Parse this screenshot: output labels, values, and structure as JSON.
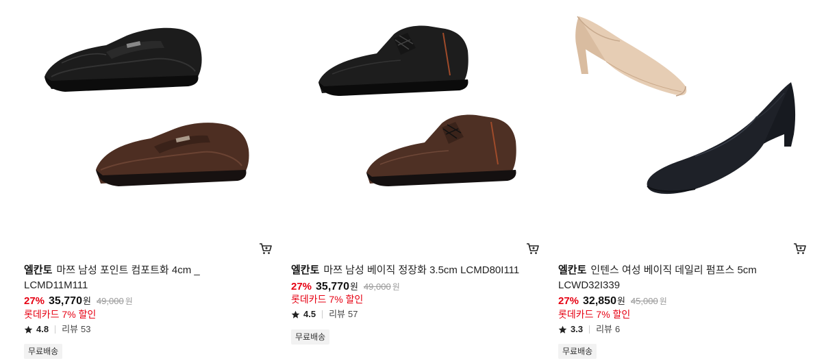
{
  "products": [
    {
      "brand": "엘칸토",
      "name": "마쯔 남성 포인트 컴포트화 4cm _ LCMD11M111",
      "discount_rate": "27%",
      "price": "35,770",
      "currency": "원",
      "original_price": "49,000",
      "original_currency": "원",
      "card_discount": "롯데카드 7% 할인",
      "rating": "4.8",
      "review_label": "리뷰",
      "review_count": "53",
      "badge": "무료배송",
      "image_icon": "shoe-loafer-black-brown",
      "colors": [
        "#1b1b1b",
        "#4a2c20"
      ]
    },
    {
      "brand": "엘칸토",
      "name": "마쯔 남성 베이직 정장화 3.5cm LCMD80I111",
      "discount_rate": "27%",
      "price": "35,770",
      "currency": "원",
      "original_price": "49,000",
      "original_currency": "원",
      "card_discount": "롯데카드 7% 할인",
      "rating": "4.5",
      "review_label": "리뷰",
      "review_count": "57",
      "badge": "무료배송",
      "image_icon": "shoe-oxford-black-brown",
      "colors": [
        "#1a1a1a",
        "#4b2e22"
      ]
    },
    {
      "brand": "엘칸토",
      "name": "인텐스 여성 베이직 데일리 펌프스 5cm LCWD32I339",
      "discount_rate": "27%",
      "price": "32,850",
      "currency": "원",
      "original_price": "45,000",
      "original_currency": "원",
      "card_discount": "롯데카드 7% 할인",
      "rating": "3.3",
      "review_label": "리뷰",
      "review_count": "6",
      "badge": "무료배송",
      "image_icon": "shoe-pump-beige-black",
      "colors": [
        "#e6cdb4",
        "#1e2128"
      ]
    }
  ],
  "accent_color": "#e60012",
  "cart_icon": "cart-icon",
  "star_icon": "star-icon"
}
